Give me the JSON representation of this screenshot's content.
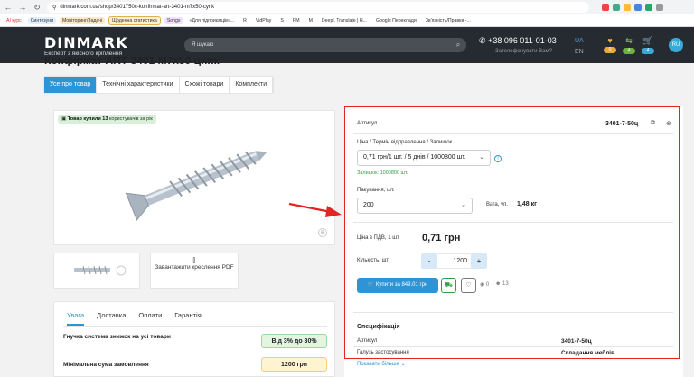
{
  "browser": {
    "url": "dinmark.com.ua/shop/3401750c-konfirmat-art-3401-m7x50-cynk",
    "bookmarks": [
      "AI курс",
      "Синтезуни",
      "Моніторинг/Задачі",
      "Щоденна статистика",
      "Songs",
      "«Для підприємців»...",
      "R",
      "VidPlay",
      "S",
      "PM",
      "M",
      "Deepl. Translate | H...",
      "Google Переклади",
      "Зв'язність/Правки -..."
    ]
  },
  "header": {
    "logo": "DINMARK",
    "logo_sub": "Експерт з якісного кріплення",
    "search_placeholder": "Я шукаю",
    "phone": "+38 096 011-01-03",
    "callback": "Зателефонувати Вам?",
    "lang_active": "UA",
    "lang_other": "EN",
    "badges": [
      "0",
      "4",
      "4"
    ],
    "user": "RU"
  },
  "page": {
    "title": "Конфірмат ART 3401 M7x50 цинк",
    "tabs": [
      "Усе про товар",
      "Технічні характеристики",
      "Схожі товари",
      "Комплекти"
    ]
  },
  "gallery": {
    "bought_prefix": "Товар купили",
    "bought_count": "13",
    "bought_suffix": "користувачів за рік",
    "drawing_label": "Завантажити креслення PDF"
  },
  "info_card": {
    "tabs": [
      "Увага",
      "Доставка",
      "Оплати",
      "Гарантія"
    ],
    "rows": [
      {
        "label": "Гнучка система знижок на усі товари",
        "value": "Від 3% до 30%"
      },
      {
        "label": "Мінімальна сума замовлення",
        "value": "1200 грн"
      }
    ]
  },
  "product": {
    "sku_label": "Артикул",
    "sku": "3401-7-50ц",
    "price_term_label": "Ціна / Термін відправлення / Залишок",
    "price_term_value": "0,71 грн/1 шт. / 5 днів / 1000800 шт.",
    "stock": "Залишок: 1000800 шт.",
    "pack_label": "Пакування, шт.",
    "pack_value": "200",
    "weight_label": "Вага, уп.",
    "weight_value": "1,48 кг",
    "price_label": "Ціна з ПДВ, 1 шт",
    "price": "0,71 грн",
    "qty_label": "Кількість, шт",
    "qty_minus": "-",
    "qty_value": "1200",
    "qty_plus": "+",
    "buy_label": "Купити за 849.01 грн",
    "views": "0",
    "users": "13",
    "spec_title": "Специфікація",
    "spec_rows": [
      {
        "label": "Артикул",
        "value": "3401-7-50ц"
      },
      {
        "label": "Галузь застосування",
        "value": "Складання меблів"
      }
    ],
    "show_more": "Показати більше"
  }
}
